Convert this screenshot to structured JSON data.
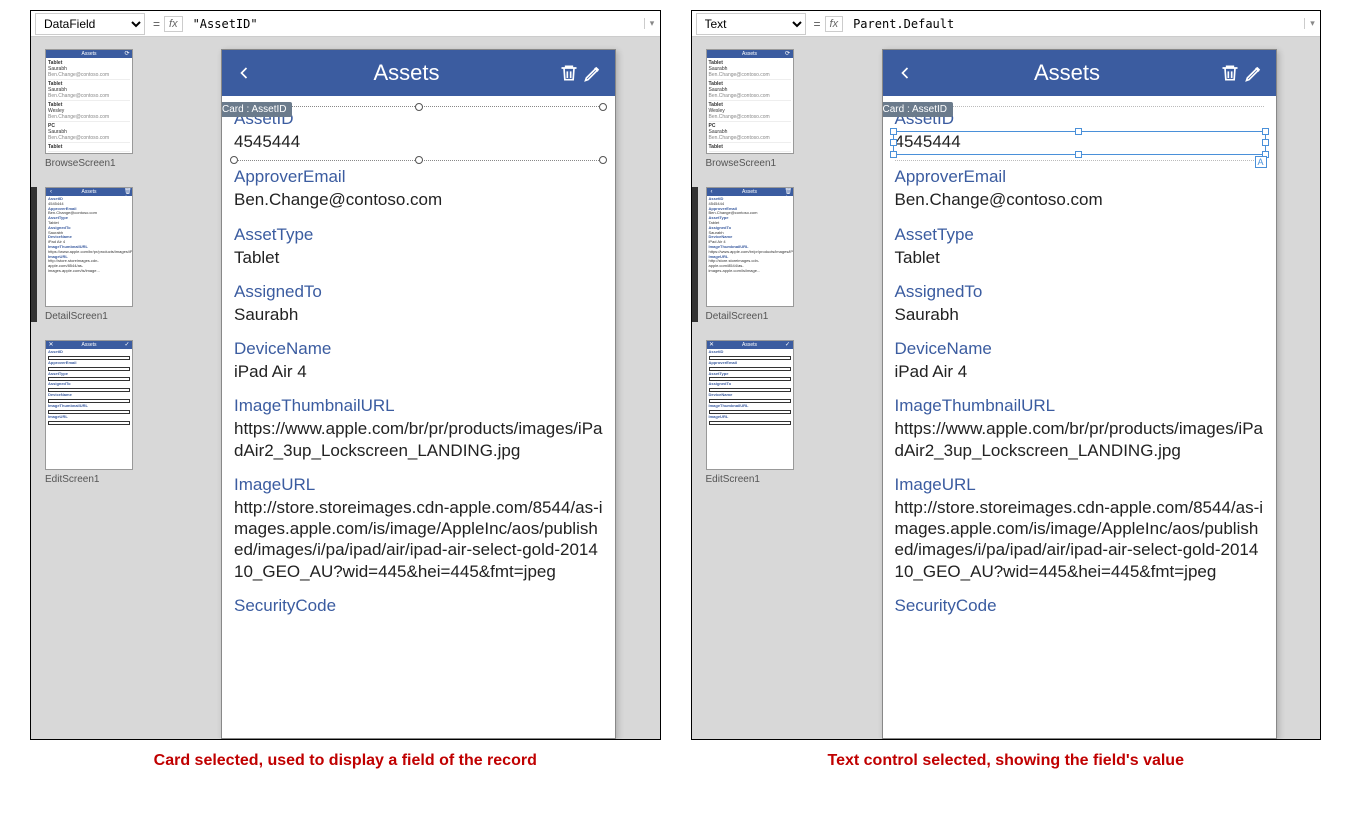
{
  "left": {
    "property_selected": "DataField",
    "formula": "\"AssetID\"",
    "caption": "Card selected, used to display a field of the record",
    "card_tag": "Card : AssetID"
  },
  "right": {
    "property_selected": "Text",
    "formula": "Parent.Default",
    "caption": "Text control selected, showing the field's value",
    "card_tag": "Card : AssetID"
  },
  "fx_label": "fx",
  "equals": "=",
  "thumbnails": {
    "browse_label": "BrowseScreen1",
    "detail_label": "DetailScreen1",
    "edit_label": "EditScreen1"
  },
  "phone": {
    "title": "Assets",
    "fields": [
      {
        "label": "AssetID",
        "value": "4545444"
      },
      {
        "label": "ApproverEmail",
        "value": "Ben.Change@contoso.com"
      },
      {
        "label": "AssetType",
        "value": "Tablet"
      },
      {
        "label": "AssignedTo",
        "value": "Saurabh"
      },
      {
        "label": "DeviceName",
        "value": "iPad Air 4"
      },
      {
        "label": "ImageThumbnailURL",
        "value": "https://www.apple.com/br/pr/products/images/iPadAir2_3up_Lockscreen_LANDING.jpg"
      },
      {
        "label": "ImageURL",
        "value": "http://store.storeimages.cdn-apple.com/8544/as-images.apple.com/is/image/AppleInc/aos/published/images/i/pa/ipad/air/ipad-air-select-gold-201410_GEO_AU?wid=445&hei=445&fmt=jpeg"
      },
      {
        "label": "SecurityCode",
        "value": ""
      }
    ]
  },
  "browse_items": [
    {
      "t": "Tablet",
      "s": "Saurabh",
      "e": "Ben.Change@contoso.com"
    },
    {
      "t": "Tablet",
      "s": "Saurabh",
      "e": "Ben.Change@contoso.com"
    },
    {
      "t": "Tablet",
      "s": "Wesley",
      "e": "Ben.Change@contoso.com"
    },
    {
      "t": "PC",
      "s": "Saurabh",
      "e": "Ben.Change@contoso.com"
    },
    {
      "t": "Tablet",
      "s": "",
      "e": ""
    }
  ]
}
